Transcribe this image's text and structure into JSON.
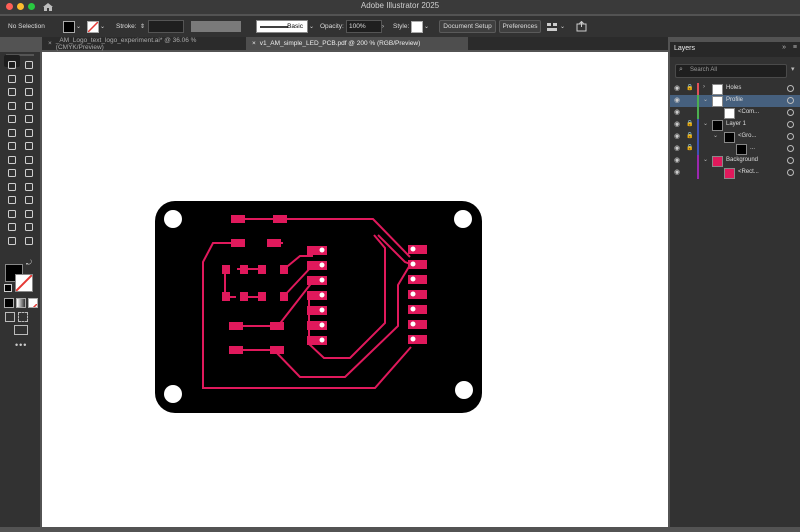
{
  "app": {
    "title": "Adobe Illustrator 2025"
  },
  "window_controls": {
    "close_color": "#ff5f57",
    "minimize_color": "#febc2e",
    "zoom_color": "#28c840"
  },
  "control_bar": {
    "selection": "No Selection",
    "stroke_label": "Stroke:",
    "brush_label": "Basic",
    "opacity_label": "Opacity:",
    "opacity_value": "100%",
    "style_label": "Style:",
    "document_setup_label": "Document Setup",
    "preferences_label": "Preferences"
  },
  "tabs": [
    {
      "label": "_AM_Logo_text_logo_experiment.ai* @ 36.06 % (CMYK/Preview)",
      "active": false
    },
    {
      "label": "v1_AM_simple_LED_PCB.pdf @ 200 % (RGB/Preview)",
      "active": true
    }
  ],
  "tools": [
    "selection-tool",
    "direct-selection-tool",
    "magic-wand-tool",
    "lasso-tool",
    "pen-tool",
    "curvature-tool",
    "type-tool",
    "line-tool",
    "rectangle-tool",
    "paintbrush-tool",
    "shaper-tool",
    "eraser-tool",
    "rotate-tool",
    "scale-tool",
    "width-tool",
    "free-transform-tool",
    "shape-builder-tool",
    "perspective-tool",
    "mesh-tool",
    "gradient-tool",
    "eyedropper-tool",
    "blend-tool",
    "symbol-sprayer-tool",
    "graph-tool",
    "artboard-tool",
    "slice-tool",
    "hand-tool",
    "zoom-tool"
  ],
  "layers_panel": {
    "title": "Layers",
    "search_placeholder": "Search All",
    "rows": [
      {
        "name": "Holes",
        "indent": 0,
        "expanded": false,
        "color": "#e0505a",
        "locked": true,
        "selected": false
      },
      {
        "name": "Profile",
        "indent": 0,
        "expanded": true,
        "color": "#4caf50",
        "locked": false,
        "selected": true
      },
      {
        "name": "<Com...",
        "indent": 1,
        "expanded": false,
        "color": "#4caf50",
        "locked": false,
        "selected": false
      },
      {
        "name": "Layer 1",
        "indent": 0,
        "expanded": true,
        "color": "#3f51b5",
        "locked": true,
        "selected": false
      },
      {
        "name": "<Gro...",
        "indent": 1,
        "expanded": true,
        "color": "#3f51b5",
        "locked": true,
        "selected": false
      },
      {
        "name": "...",
        "indent": 2,
        "expanded": false,
        "color": "#3f51b5",
        "locked": true,
        "selected": false
      },
      {
        "name": "Background",
        "indent": 0,
        "expanded": true,
        "color": "#9c27b0",
        "locked": false,
        "selected": false
      },
      {
        "name": "<Rect...",
        "indent": 1,
        "expanded": false,
        "color": "#9c27b0",
        "locked": false,
        "selected": false
      }
    ]
  },
  "artwork": {
    "board_color": "#000000",
    "trace_color": "#e0195c"
  }
}
